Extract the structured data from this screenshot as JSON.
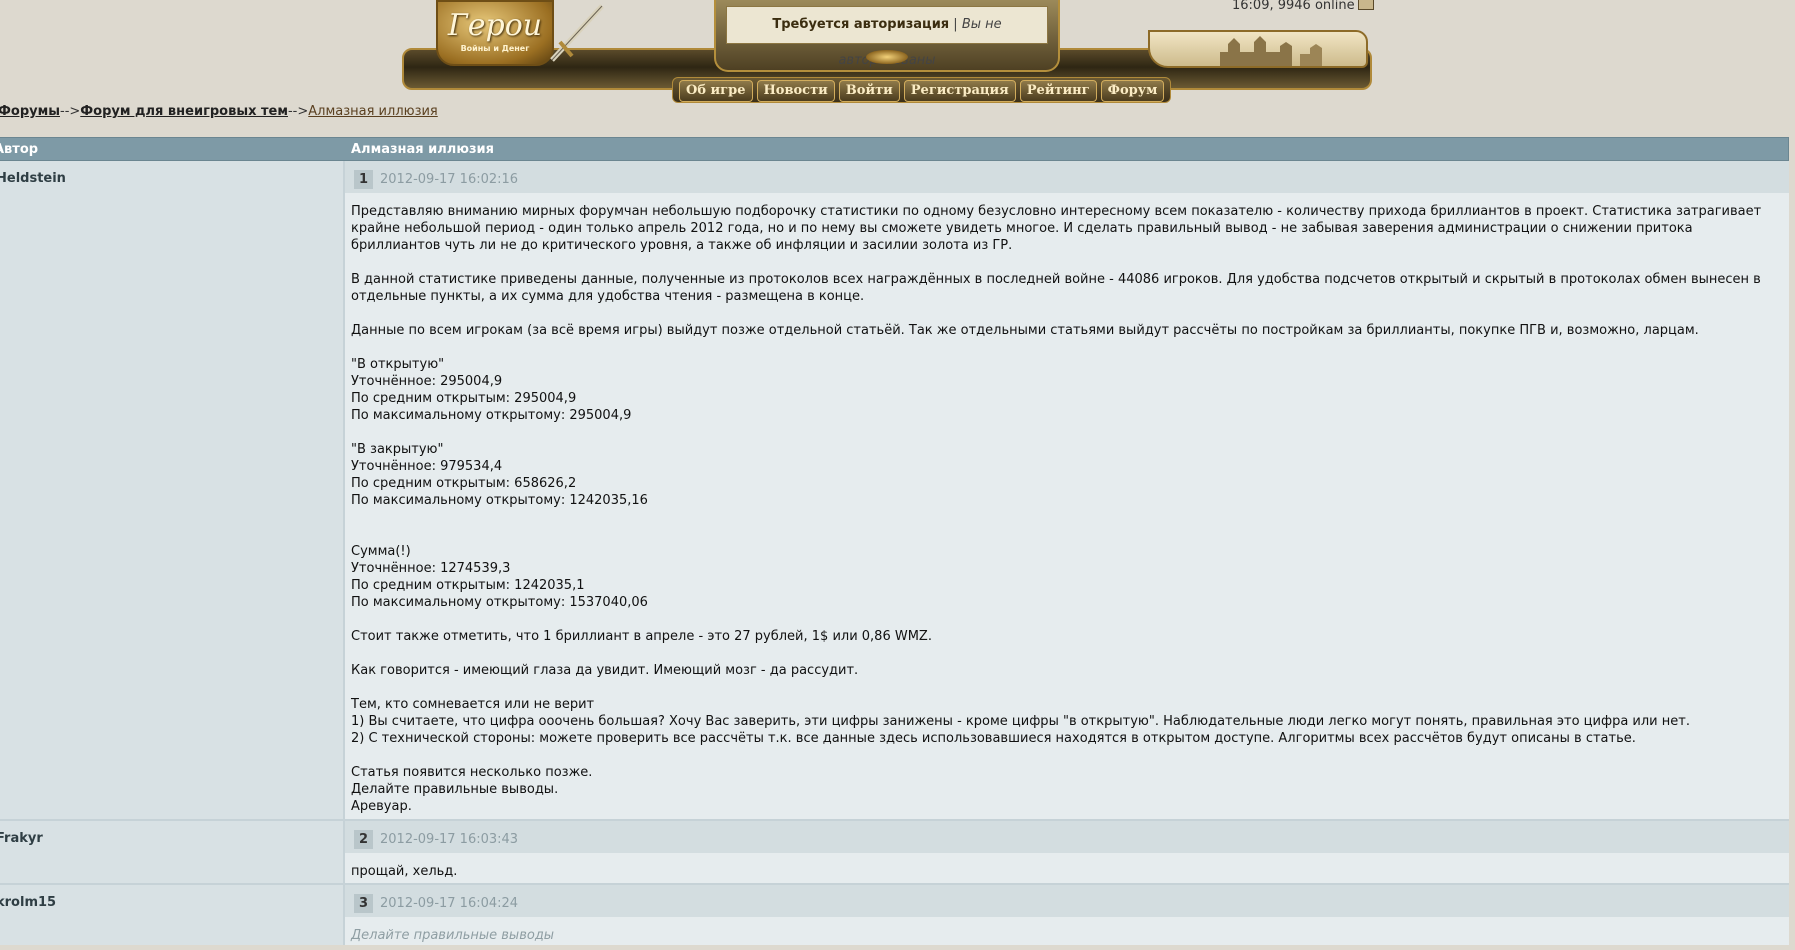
{
  "header": {
    "logo_title": "Герои",
    "logo_subtitle": "Войны и Денег",
    "auth_required": "Требуется авторизация",
    "auth_separator": " | ",
    "auth_status": "Вы не авторизованы",
    "time_online": "16:09, 9946 online",
    "nav": [
      {
        "label": "Об игре"
      },
      {
        "label": "Новости"
      },
      {
        "label": "Войти"
      },
      {
        "label": "Регистрация"
      },
      {
        "label": "Рейтинг"
      },
      {
        "label": "Форум"
      }
    ]
  },
  "breadcrumb": {
    "forums": "Форумы",
    "sep1": "-->",
    "offtopic": "Форум для внеигровых тем",
    "sep2": "-->",
    "current": "Алмазная иллюзия"
  },
  "table": {
    "col_author": "Автор",
    "col_title": "Алмазная иллюзия"
  },
  "posts": [
    {
      "author": "Heldstein",
      "number": "1",
      "date": "2012-09-17 16:02:16",
      "text": "Представляю вниманию мирных форумчан небольшую подборочку статистики по одному безусловно интересному всем показателю - количеству прихода бриллиантов в проект. Статистика затрагивает крайне небольшой период - один только апрель 2012 года, но и по нему вы сможете увидеть многое. И сделать правильный вывод - не забывая заверения администрации о снижении притока бриллиантов чуть ли не до критического уровня, а также об инфляции и засилии золота из ГР.\n\nВ данной статистике приведены данные, полученные из протоколов всех награждённых в последней войне - 44086 игроков. Для удобства подсчетов открытый и скрытый в протоколах обмен вынесен в отдельные пункты, а их сумма для удобства чтения - размещена в конце.\n\nДанные по всем игрокам (за всё время игры) выйдут позже отдельной статьёй. Так же отдельными статьями выйдут рассчёты по постройкам за бриллианты, покупке ПГВ и, возможно, ларцам.\n\n\"В открытую\"\nУточнённое: 295004,9\nПо средним открытым: 295004,9\nПо максимальному открытому: 295004,9\n\n\"В закрытую\"\nУточнённое: 979534,4\nПо средним открытым: 658626,2\nПо максимальному открытому: 1242035,16\n\n\nСумма(!)\nУточнённое: 1274539,3\nПо средним открытым: 1242035,1\nПо максимальному открытому: 1537040,06\n\nСтоит также отметить, что 1 бриллиант в апреле - это 27 рублей, 1$ или 0,86 WMZ.\n\nКак говорится - имеющий глаза да увидит. Имеющий мозг - да рассудит.\n\nТем, кто сомневается или не верит\n1) Вы считаете, что цифра ооочень большая? Хочу Вас заверить, эти цифры занижены - кроме цифры \"в открытую\". Наблюдательные люди легко могут понять, правильная это цифра или нет.\n2) С технической стороны: можете проверить все рассчёты т.к. все данные здесь использовавшиеся находятся в открытом доступе. Алгоритмы всех рассчётов будут описаны в статье.\n\nСтатья появится несколько позже.\nДелайте правильные выводы.\nАревуар."
    },
    {
      "author": "Frakyr",
      "number": "2",
      "date": "2012-09-17 16:03:43",
      "text": "прощай, хельд."
    },
    {
      "author": "krolm15",
      "number": "3",
      "date": "2012-09-17 16:04:24",
      "text": "Делайте правильные выводы"
    }
  ]
}
